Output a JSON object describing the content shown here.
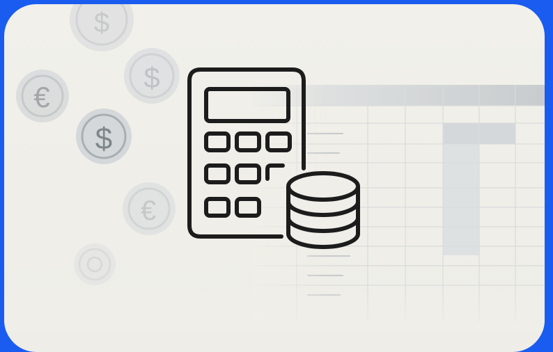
{
  "illustration": {
    "subject": "calculator-with-coin-stack",
    "background": "spreadsheet-grid",
    "coins": [
      "dollar",
      "dollar",
      "euro",
      "dollar",
      "euro",
      "generic"
    ]
  },
  "colors": {
    "frame": "#1a5cf0",
    "card_background": "#f0efe9",
    "icon_stroke": "#1c1c1c",
    "coin_fill": "#d9dcde",
    "coin_symbol": "#a7acb0",
    "grid_line": "#d7dadb",
    "grid_header": "#c9cdd0",
    "grid_highlight": "#d2d6d9"
  },
  "icons": {
    "dollar": "$",
    "euro": "€"
  }
}
